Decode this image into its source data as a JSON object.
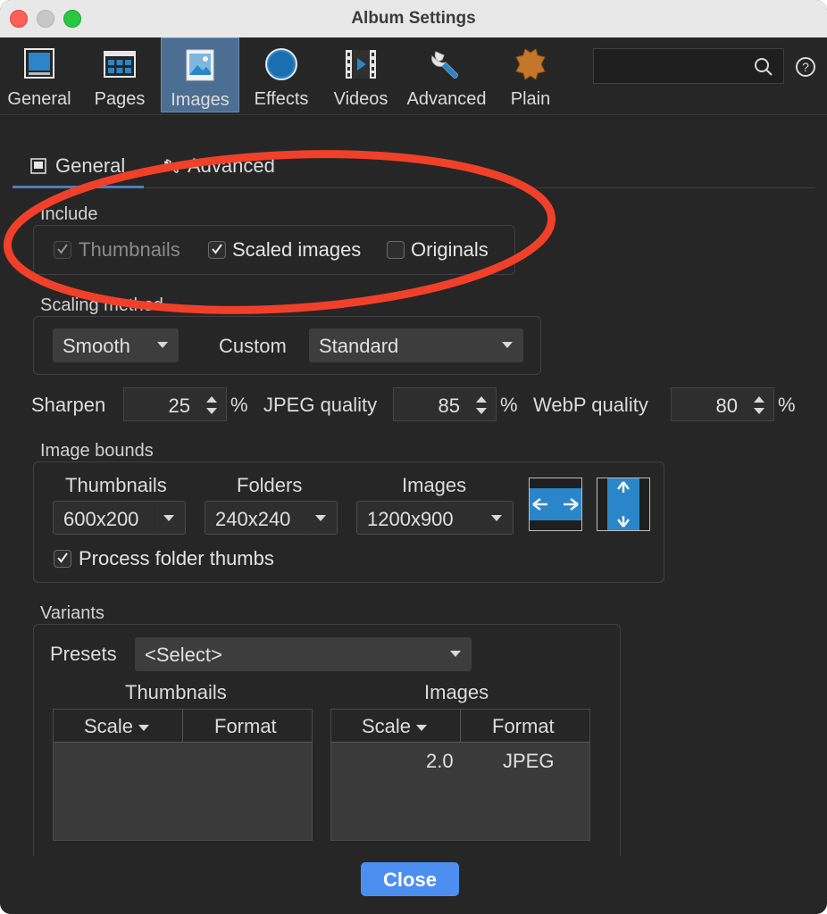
{
  "window": {
    "title": "Album Settings"
  },
  "toolbar": {
    "items": [
      {
        "label": "General",
        "icon": "general-icon"
      },
      {
        "label": "Pages",
        "icon": "pages-icon"
      },
      {
        "label": "Images",
        "icon": "images-icon",
        "active": true
      },
      {
        "label": "Effects",
        "icon": "effects-icon"
      },
      {
        "label": "Videos",
        "icon": "videos-icon"
      },
      {
        "label": "Advanced",
        "icon": "wrench-icon"
      },
      {
        "label": "Plain",
        "icon": "leather-icon"
      }
    ],
    "search_placeholder": ""
  },
  "subtabs": [
    {
      "label": "General",
      "active": true
    },
    {
      "label": "Advanced",
      "active": false
    }
  ],
  "include": {
    "label": "Include",
    "thumbnails": {
      "label": "Thumbnails",
      "checked": true,
      "disabled": true
    },
    "scaled": {
      "label": "Scaled images",
      "checked": true
    },
    "originals": {
      "label": "Originals",
      "checked": false
    }
  },
  "scaling": {
    "label": "Scaling method",
    "method": "Smooth",
    "custom_label": "Custom",
    "custom_value": "Standard"
  },
  "quality": {
    "sharpen_label": "Sharpen",
    "sharpen_value": "25",
    "sharpen_unit": "%",
    "jpeg_label": "JPEG quality",
    "jpeg_value": "85",
    "jpeg_unit": "%",
    "webp_label": "WebP quality",
    "webp_value": "80",
    "webp_unit": "%"
  },
  "bounds": {
    "label": "Image bounds",
    "thumbnails_label": "Thumbnails",
    "thumbnails_value": "600x200",
    "folders_label": "Folders",
    "folders_value": "240x240",
    "images_label": "Images",
    "images_value": "1200x900",
    "process_label": "Process folder thumbs",
    "process_checked": true
  },
  "variants": {
    "label": "Variants",
    "presets_label": "Presets",
    "presets_value": "<Select>",
    "thumbnails_title": "Thumbnails",
    "images_title": "Images",
    "col_scale": "Scale",
    "col_format": "Format",
    "images_rows": [
      {
        "scale": "2.0",
        "format": "JPEG"
      }
    ]
  },
  "close_label": "Close",
  "colors": {
    "accent": "#4d8ff0",
    "active_tab": "#4c6e93",
    "annotation": "#f0402a",
    "fit_blue": "#2a86c8"
  }
}
